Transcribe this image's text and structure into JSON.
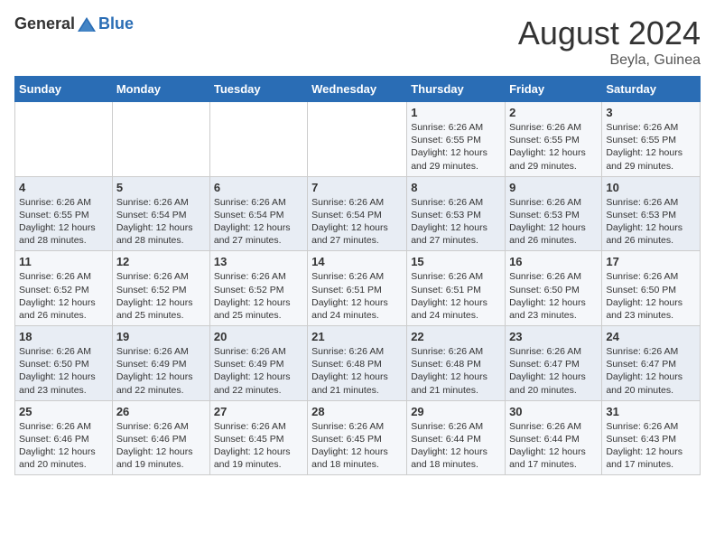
{
  "header": {
    "logo_general": "General",
    "logo_blue": "Blue",
    "month_title": "August 2024",
    "location": "Beyla, Guinea"
  },
  "days_of_week": [
    "Sunday",
    "Monday",
    "Tuesday",
    "Wednesday",
    "Thursday",
    "Friday",
    "Saturday"
  ],
  "weeks": [
    [
      {
        "num": "",
        "info": ""
      },
      {
        "num": "",
        "info": ""
      },
      {
        "num": "",
        "info": ""
      },
      {
        "num": "",
        "info": ""
      },
      {
        "num": "1",
        "info": "Sunrise: 6:26 AM\nSunset: 6:55 PM\nDaylight: 12 hours\nand 29 minutes."
      },
      {
        "num": "2",
        "info": "Sunrise: 6:26 AM\nSunset: 6:55 PM\nDaylight: 12 hours\nand 29 minutes."
      },
      {
        "num": "3",
        "info": "Sunrise: 6:26 AM\nSunset: 6:55 PM\nDaylight: 12 hours\nand 29 minutes."
      }
    ],
    [
      {
        "num": "4",
        "info": "Sunrise: 6:26 AM\nSunset: 6:55 PM\nDaylight: 12 hours\nand 28 minutes."
      },
      {
        "num": "5",
        "info": "Sunrise: 6:26 AM\nSunset: 6:54 PM\nDaylight: 12 hours\nand 28 minutes."
      },
      {
        "num": "6",
        "info": "Sunrise: 6:26 AM\nSunset: 6:54 PM\nDaylight: 12 hours\nand 27 minutes."
      },
      {
        "num": "7",
        "info": "Sunrise: 6:26 AM\nSunset: 6:54 PM\nDaylight: 12 hours\nand 27 minutes."
      },
      {
        "num": "8",
        "info": "Sunrise: 6:26 AM\nSunset: 6:53 PM\nDaylight: 12 hours\nand 27 minutes."
      },
      {
        "num": "9",
        "info": "Sunrise: 6:26 AM\nSunset: 6:53 PM\nDaylight: 12 hours\nand 26 minutes."
      },
      {
        "num": "10",
        "info": "Sunrise: 6:26 AM\nSunset: 6:53 PM\nDaylight: 12 hours\nand 26 minutes."
      }
    ],
    [
      {
        "num": "11",
        "info": "Sunrise: 6:26 AM\nSunset: 6:52 PM\nDaylight: 12 hours\nand 26 minutes."
      },
      {
        "num": "12",
        "info": "Sunrise: 6:26 AM\nSunset: 6:52 PM\nDaylight: 12 hours\nand 25 minutes."
      },
      {
        "num": "13",
        "info": "Sunrise: 6:26 AM\nSunset: 6:52 PM\nDaylight: 12 hours\nand 25 minutes."
      },
      {
        "num": "14",
        "info": "Sunrise: 6:26 AM\nSunset: 6:51 PM\nDaylight: 12 hours\nand 24 minutes."
      },
      {
        "num": "15",
        "info": "Sunrise: 6:26 AM\nSunset: 6:51 PM\nDaylight: 12 hours\nand 24 minutes."
      },
      {
        "num": "16",
        "info": "Sunrise: 6:26 AM\nSunset: 6:50 PM\nDaylight: 12 hours\nand 23 minutes."
      },
      {
        "num": "17",
        "info": "Sunrise: 6:26 AM\nSunset: 6:50 PM\nDaylight: 12 hours\nand 23 minutes."
      }
    ],
    [
      {
        "num": "18",
        "info": "Sunrise: 6:26 AM\nSunset: 6:50 PM\nDaylight: 12 hours\nand 23 minutes."
      },
      {
        "num": "19",
        "info": "Sunrise: 6:26 AM\nSunset: 6:49 PM\nDaylight: 12 hours\nand 22 minutes."
      },
      {
        "num": "20",
        "info": "Sunrise: 6:26 AM\nSunset: 6:49 PM\nDaylight: 12 hours\nand 22 minutes."
      },
      {
        "num": "21",
        "info": "Sunrise: 6:26 AM\nSunset: 6:48 PM\nDaylight: 12 hours\nand 21 minutes."
      },
      {
        "num": "22",
        "info": "Sunrise: 6:26 AM\nSunset: 6:48 PM\nDaylight: 12 hours\nand 21 minutes."
      },
      {
        "num": "23",
        "info": "Sunrise: 6:26 AM\nSunset: 6:47 PM\nDaylight: 12 hours\nand 20 minutes."
      },
      {
        "num": "24",
        "info": "Sunrise: 6:26 AM\nSunset: 6:47 PM\nDaylight: 12 hours\nand 20 minutes."
      }
    ],
    [
      {
        "num": "25",
        "info": "Sunrise: 6:26 AM\nSunset: 6:46 PM\nDaylight: 12 hours\nand 20 minutes."
      },
      {
        "num": "26",
        "info": "Sunrise: 6:26 AM\nSunset: 6:46 PM\nDaylight: 12 hours\nand 19 minutes."
      },
      {
        "num": "27",
        "info": "Sunrise: 6:26 AM\nSunset: 6:45 PM\nDaylight: 12 hours\nand 19 minutes."
      },
      {
        "num": "28",
        "info": "Sunrise: 6:26 AM\nSunset: 6:45 PM\nDaylight: 12 hours\nand 18 minutes."
      },
      {
        "num": "29",
        "info": "Sunrise: 6:26 AM\nSunset: 6:44 PM\nDaylight: 12 hours\nand 18 minutes."
      },
      {
        "num": "30",
        "info": "Sunrise: 6:26 AM\nSunset: 6:44 PM\nDaylight: 12 hours\nand 17 minutes."
      },
      {
        "num": "31",
        "info": "Sunrise: 6:26 AM\nSunset: 6:43 PM\nDaylight: 12 hours\nand 17 minutes."
      }
    ]
  ]
}
